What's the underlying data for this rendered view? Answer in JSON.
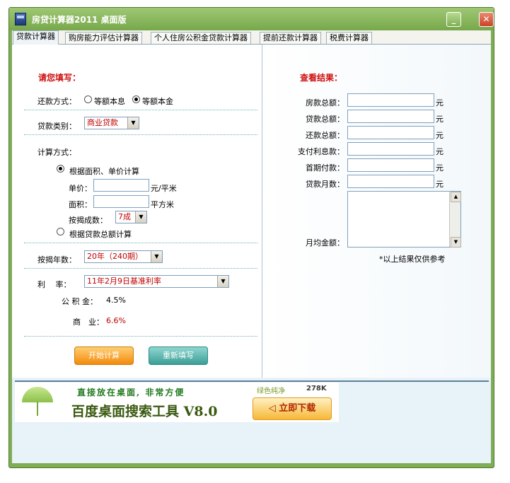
{
  "window": {
    "title": "房贷计算器2011 桌面版",
    "min_glyph": "_",
    "close_glyph": "✕"
  },
  "tabs": [
    {
      "label": "贷款计算器",
      "active": true
    },
    {
      "label": "购房能力评估计算器",
      "active": false
    },
    {
      "label": "个人住房公积金贷款计算器",
      "active": false
    },
    {
      "label": "提前还款计算器",
      "active": false
    },
    {
      "label": "税费计算器",
      "active": false
    }
  ],
  "form": {
    "heading": "请您填写：",
    "repayment_label": "还款方式：",
    "repayment_opt1": "等额本息",
    "repayment_opt2": "等额本金",
    "loan_type_label": "贷款类别：",
    "loan_type_value": "商业贷款",
    "calc_method_label": "计算方式：",
    "method_opt1": "根据面积、单价计算",
    "unit_price_label": "单价：",
    "unit_price_unit": "元/平米",
    "area_label": "面积：",
    "area_unit": "平方米",
    "mortgage_ratio_label": "按揭成数：",
    "mortgage_ratio_value": "7成",
    "method_opt2": "根据贷款总额计算",
    "years_label": "按揭年数：",
    "years_value": "20年（240期）",
    "rate_label": "利　 率：",
    "rate_value": "11年2月9日基准利率",
    "fund_label": "公 积 金：",
    "fund_value": "4.5%",
    "commercial_label": "商　业：",
    "commercial_value": "6.6%",
    "start_button": "开始计算",
    "reset_button": "重新填写"
  },
  "results": {
    "heading": "查看结果：",
    "rows": [
      {
        "label": "房款总额：",
        "unit": "元"
      },
      {
        "label": "贷款总额：",
        "unit": "元"
      },
      {
        "label": "还款总额：",
        "unit": "元"
      },
      {
        "label": "支付利息款：",
        "unit": "元"
      },
      {
        "label": "首期付款：",
        "unit": "元"
      },
      {
        "label": "贷款月数：",
        "unit": "元"
      }
    ],
    "monthly_label": "月均金额：",
    "note": "*以上结果仅供参考"
  },
  "banner": {
    "slogan": "直接放在桌面, 非常方便",
    "product": "百度桌面搜索工具 V8.0",
    "tag": "绿色纯净",
    "size": "278K",
    "download": "立即下载"
  },
  "colors": {
    "accent_red": "#d01010",
    "window_green": "#7fae56",
    "start_button": "#f28a0c",
    "reset_button": "#3c9e96"
  }
}
